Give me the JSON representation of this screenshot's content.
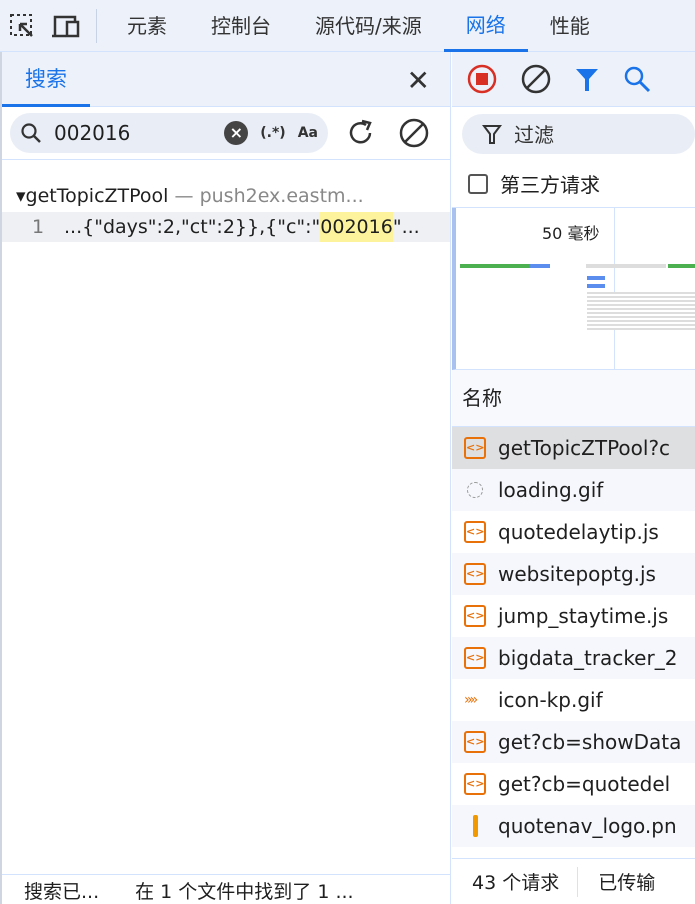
{
  "topbar": {
    "tabs": [
      "元素",
      "控制台",
      "源代码/来源",
      "网络",
      "性能"
    ],
    "active": "网络"
  },
  "search": {
    "tab_label": "搜索",
    "query": "002016",
    "regex_label": "(.*)",
    "case_label": "Aa",
    "result_file": "getTopicZTPool",
    "result_host": "push2ex.eastm...",
    "line_number": "1",
    "line_prefix": "...{\"days\":2,\"ct\":2}},{\"c\":\"",
    "line_match": "002016",
    "line_suffix": "\"...",
    "footer_status": "搜索已...",
    "footer_summary": "在 1 个文件中找到了 1 ..."
  },
  "network": {
    "filter_placeholder": "过滤",
    "third_party_label": "第三方请求",
    "timeline_label": "50 毫秒",
    "name_header": "名称",
    "rows": [
      {
        "name": "getTopicZTPool?c",
        "icon": "script"
      },
      {
        "name": "loading.gif",
        "icon": "image-loading"
      },
      {
        "name": "quotedelaytip.js",
        "icon": "script"
      },
      {
        "name": "websitepoptg.js",
        "icon": "script"
      },
      {
        "name": "jump_staytime.js",
        "icon": "script"
      },
      {
        "name": "bigdata_tracker_2",
        "icon": "script"
      },
      {
        "name": "icon-kp.gif",
        "icon": "image-arrows"
      },
      {
        "name": "get?cb=showData",
        "icon": "script"
      },
      {
        "name": "get?cb=quotedel",
        "icon": "script"
      },
      {
        "name": "quotenav_logo.pn",
        "icon": "image"
      }
    ],
    "footer_requests": "43 个请求",
    "footer_transferred": "已传输"
  },
  "colors": {
    "accent": "#1a73e8",
    "record": "#d93025",
    "script": "#e8710a"
  }
}
